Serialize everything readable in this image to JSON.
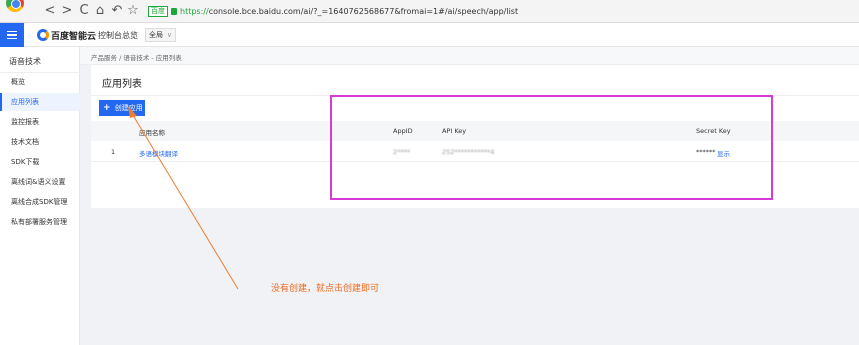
{
  "browser": {
    "nav_back": "<",
    "nav_forward": ">",
    "nav_reload": "C",
    "nav_home": "⌂",
    "nav_undo": "↶",
    "nav_star": "☆",
    "url_badge": "百度",
    "url_scheme": "https://",
    "url_rest": "console.bce.baidu.com/ai/?_=1640762568677&fromai=1#/ai/speech/app/list"
  },
  "app_bar": {
    "brand": "百度智能云",
    "console": "控制台总览",
    "region": "全局"
  },
  "sidebar": {
    "title": "语音技术",
    "items": [
      {
        "label": "概览",
        "active": false
      },
      {
        "label": "应用列表",
        "active": true
      },
      {
        "label": "监控报表",
        "active": false
      },
      {
        "label": "技术文档",
        "active": false
      },
      {
        "label": "SDK下载",
        "active": false
      },
      {
        "label": "离线词&语义设置",
        "active": false
      },
      {
        "label": "离线合成SDK管理",
        "active": false
      },
      {
        "label": "私有部署服务管理",
        "active": false
      }
    ]
  },
  "breadcrumb": "产品服务 / 语音技术 - 应用列表",
  "main": {
    "title": "应用列表",
    "create_button": "创建应用",
    "create_plus": "+",
    "columns": [
      "应用名称",
      "AppID",
      "API Key",
      "Secret Key"
    ],
    "rows": [
      {
        "index": "1",
        "name": "多语模块翻译",
        "app_id": "2****",
        "api_key": "2S2***********4",
        "secret_key": "******",
        "action": "显示"
      }
    ]
  },
  "annotation": {
    "text": "没有创建，就点击创建即可",
    "arrow_color": "#f07c2e",
    "box_color": "#d83ad8"
  },
  "colors": {
    "accent": "#2468f2",
    "annotation_orange": "#ec6a1e"
  }
}
